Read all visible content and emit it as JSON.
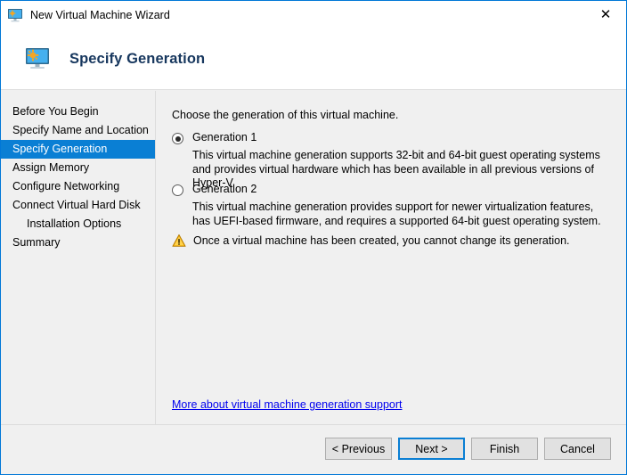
{
  "window": {
    "title": "New Virtual Machine Wizard",
    "title_icon": "virtual-machine-monitor-icon",
    "close_label": "✕"
  },
  "header": {
    "icon": "virtual-machine-monitor-icon",
    "title": "Specify Generation"
  },
  "sidebar": {
    "items": [
      {
        "label": "Before You Begin",
        "selected": false,
        "indented": false
      },
      {
        "label": "Specify Name and Location",
        "selected": false,
        "indented": false
      },
      {
        "label": "Specify Generation",
        "selected": true,
        "indented": false
      },
      {
        "label": "Assign Memory",
        "selected": false,
        "indented": false
      },
      {
        "label": "Configure Networking",
        "selected": false,
        "indented": false
      },
      {
        "label": "Connect Virtual Hard Disk",
        "selected": false,
        "indented": false
      },
      {
        "label": "Installation Options",
        "selected": false,
        "indented": true
      },
      {
        "label": "Summary",
        "selected": false,
        "indented": false
      }
    ]
  },
  "main": {
    "intro": "Choose the generation of this virtual machine.",
    "options": [
      {
        "label": "Generation 1",
        "selected": true,
        "description": "This virtual machine generation supports 32-bit and 64-bit guest operating systems and provides virtual hardware which has been available in all previous versions of Hyper-V."
      },
      {
        "label": "Generation 2",
        "selected": false,
        "description": "This virtual machine generation provides support for newer virtualization features, has UEFI-based firmware, and requires a supported 64-bit guest operating system."
      }
    ],
    "warning": {
      "icon": "warning-triangle-icon",
      "text": "Once a virtual machine has been created, you cannot change its generation."
    },
    "help_link": "More about virtual machine generation support"
  },
  "footer": {
    "buttons": [
      {
        "label": "< Previous",
        "default": false
      },
      {
        "label": "Next >",
        "default": true
      },
      {
        "label": "Finish",
        "default": false
      },
      {
        "label": "Cancel",
        "default": false
      }
    ]
  },
  "colors": {
    "accent": "#0a7fd4",
    "window_border": "#0078d7",
    "link": "#0000ee",
    "header_title": "#17375e",
    "warning": "#ffb900",
    "body_bg": "#f0f0f0"
  }
}
